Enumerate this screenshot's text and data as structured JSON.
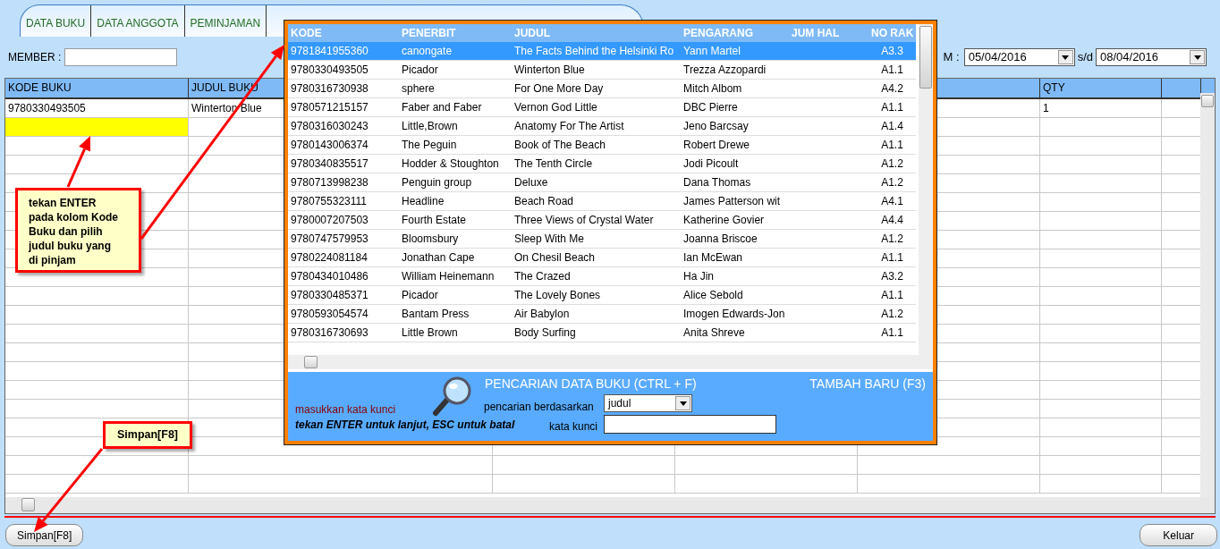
{
  "tabs": [
    {
      "label": "DATA BUKU"
    },
    {
      "label": "DATA ANGGOTA"
    },
    {
      "label": "PEMINJAMAN"
    }
  ],
  "member": {
    "label": "MEMBER :"
  },
  "date_filter": {
    "label": "M :",
    "from": "05/04/2016",
    "separator": "s/d",
    "to": "08/04/2016"
  },
  "loan_table": {
    "columns": [
      {
        "label": "KODE BUKU"
      },
      {
        "label": "JUDUL BUKU"
      },
      {},
      {},
      {},
      {
        "label": "QTY"
      },
      {}
    ],
    "rows": [
      {
        "kode_buku": "9780330493505",
        "judul_buku": "Winterton Blue",
        "qty": "1",
        "selected": false
      },
      {
        "selected": true
      }
    ]
  },
  "book_lookup": {
    "columns": [
      "KODE",
      "PENERBIT",
      "JUDUL",
      "PENGARANG",
      "JUM HAL",
      "NO RAK"
    ],
    "rows": [
      {
        "kode": "9781841955360",
        "penerbit": "canongate",
        "judul": "The Facts Behind the Helsinki Ro",
        "pengarang": "Yann Martel",
        "no_rak": "A3.3",
        "selected": true
      },
      {
        "kode": "9780330493505",
        "penerbit": "Picador",
        "judul": "Winterton Blue",
        "pengarang": "Trezza Azzopardi",
        "no_rak": "A1.1",
        "selected": false
      },
      {
        "kode": "9780316730938",
        "penerbit": "sphere",
        "judul": "For One More Day",
        "pengarang": "Mitch Albom",
        "no_rak": "A4.2",
        "selected": false
      },
      {
        "kode": "9780571215157",
        "penerbit": "Faber and Faber",
        "judul": "Vernon God Little",
        "pengarang": "DBC Pierre",
        "no_rak": "A1.1",
        "selected": false
      },
      {
        "kode": "9780316030243",
        "penerbit": "Little,Brown",
        "judul": "Anatomy For The Artist",
        "pengarang": "Jeno Barcsay",
        "no_rak": "A1.4",
        "selected": false
      },
      {
        "kode": "9780143006374",
        "penerbit": "The Peguin",
        "judul": "Book of The Beach",
        "pengarang": "Robert Drewe",
        "no_rak": "A1.1",
        "selected": false
      },
      {
        "kode": "9780340835517",
        "penerbit": "Hodder & Stoughton",
        "judul": "The Tenth Circle",
        "pengarang": "Jodi Picoult",
        "no_rak": "A1.2",
        "selected": false
      },
      {
        "kode": "9780713998238",
        "penerbit": "Penguin group",
        "judul": "Deluxe",
        "pengarang": "Dana Thomas",
        "no_rak": "A1.2",
        "selected": false
      },
      {
        "kode": "9780755323111",
        "penerbit": "Headline",
        "judul": "Beach Road",
        "pengarang": "James Patterson wit",
        "no_rak": "A4.1",
        "selected": false
      },
      {
        "kode": "9780007207503",
        "penerbit": "Fourth Estate",
        "judul": "Three Views of Crystal Water",
        "pengarang": "Katherine Govier",
        "no_rak": "A4.4",
        "selected": false
      },
      {
        "kode": "9780747579953",
        "penerbit": "Bloomsbury",
        "judul": "Sleep With Me",
        "pengarang": "Joanna Briscoe",
        "no_rak": "A1.2",
        "selected": false
      },
      {
        "kode": "9780224081184",
        "penerbit": "Jonathan Cape",
        "judul": "On Chesil Beach",
        "pengarang": "Ian McEwan",
        "no_rak": "A1.1",
        "selected": false
      },
      {
        "kode": "9780434010486",
        "penerbit": "William Heinemann",
        "judul": "The Crazed",
        "pengarang": "Ha Jin",
        "no_rak": "A3.2",
        "selected": false
      },
      {
        "kode": "9780330485371",
        "penerbit": "Picador",
        "judul": "The Lovely Bones",
        "pengarang": "Alice Sebold",
        "no_rak": "A1.1",
        "selected": false
      },
      {
        "kode": "9780593054574",
        "penerbit": "Bantam Press",
        "judul": "Air Babylon",
        "pengarang": "Imogen Edwards-Jon",
        "no_rak": "A1.2",
        "selected": false
      },
      {
        "kode": "9780316730693",
        "penerbit": "Little Brown",
        "judul": "Body Surfing",
        "pengarang": "Anita Shreve",
        "no_rak": "A1.1",
        "selected": false
      }
    ],
    "search": {
      "title": "PENCARIAN DATA BUKU (CTRL + F)",
      "add_new": "TAMBAH BARU (F3)",
      "hint": "masukkan kata kunci",
      "instructions": "tekan ENTER untuk lanjut, ESC untuk batal",
      "by_label": "pencarian berdasarkan",
      "by_value": "judul",
      "keyword_label": "kata kunci"
    }
  },
  "callouts": [
    {
      "text": "tekan ENTER pada kolom Kode Buku dan pilih judul buku yang di pinjam"
    },
    {
      "text": "Simpan[F8]"
    }
  ],
  "buttons": [
    "Simpan[F8]",
    "Keluar"
  ]
}
